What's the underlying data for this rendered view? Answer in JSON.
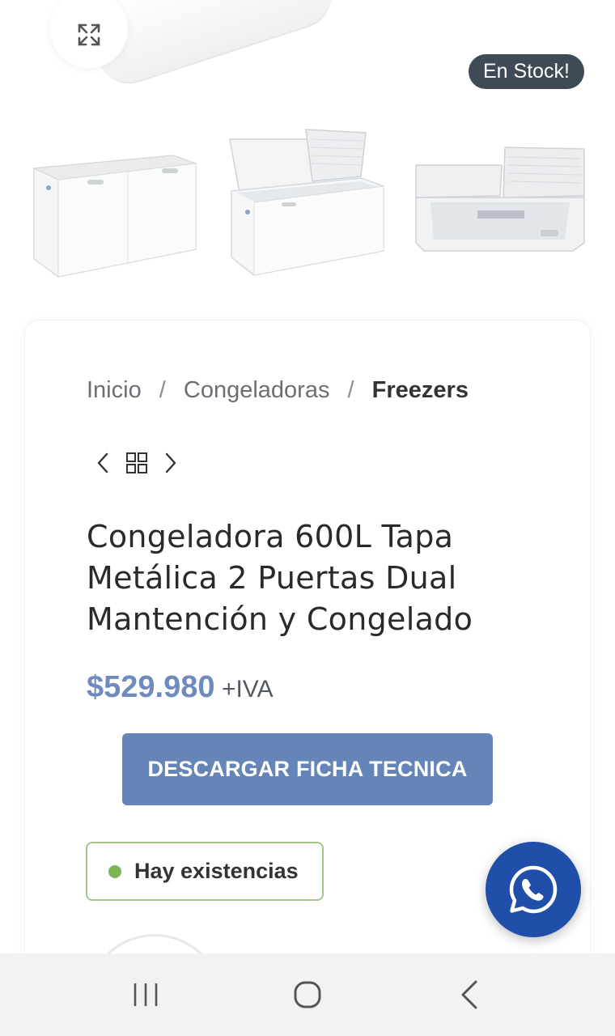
{
  "gallery": {
    "stock_badge": "En Stock!",
    "thumbnails": [
      "freezer-closed",
      "freezer-open-lids",
      "freezer-interior"
    ]
  },
  "breadcrumb": {
    "items": [
      "Inicio",
      "Congeladoras"
    ],
    "separator": "/",
    "current": "Freezers"
  },
  "product": {
    "title": "Congeladora 600L Tapa Metálica 2 Puertas Dual Mantención y Congelado",
    "price": "$529.980",
    "tax_suffix": "+IVA",
    "download_label": "DESCARGAR FICHA TECNICA",
    "stock_status": "Hay existencias"
  },
  "colors": {
    "accent_blue": "#6584b8",
    "price_blue": "#6f8bbd",
    "badge_bg": "#3e4a55",
    "stock_green": "#7db455",
    "whatsapp_bg": "#1f4fa8"
  },
  "icons": {
    "expand": "expand-icon",
    "prev": "chevron-left-icon",
    "grid": "grid-icon",
    "next": "chevron-right-icon",
    "whatsapp": "whatsapp-icon",
    "recents": "recents-icon",
    "home": "home-icon",
    "back": "back-icon"
  }
}
